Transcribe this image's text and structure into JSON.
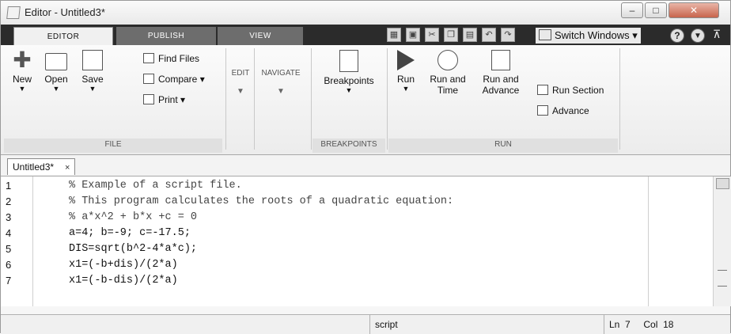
{
  "window": {
    "title": "Editor - Untitled3*"
  },
  "tabs": [
    {
      "label": "EDITOR"
    },
    {
      "label": "PUBLISH"
    },
    {
      "label": "VIEW"
    }
  ],
  "toolbar": {
    "switch_windows": "Switch Windows",
    "help_icon": "question-icon"
  },
  "ribbon": {
    "file": {
      "new": "New",
      "open": "Open",
      "save": "Save",
      "find_files": "Find Files",
      "compare": "Compare",
      "print": "Print",
      "section": "FILE"
    },
    "edit": "EDIT",
    "navigate": "NAVIGATE",
    "breakpoints": {
      "button": "Breakpoints",
      "section": "BREAKPOINTS"
    },
    "run": {
      "run": "Run",
      "run_and_time_1": "Run and",
      "run_and_time_2": "Time",
      "run_and_advance_1": "Run and",
      "run_and_advance_2": "Advance",
      "run_section": "Run Section",
      "advance": "Advance",
      "section": "RUN"
    }
  },
  "doc_tab": {
    "label": "Untitled3*",
    "close": "×"
  },
  "editor": {
    "lines": [
      {
        "num": "1",
        "text": "% Example of a script file."
      },
      {
        "num": "2",
        "text": "% This program calculates the roots of a quadratic equation:"
      },
      {
        "num": "3",
        "text": "% a*x^2 + b*x +c = 0"
      },
      {
        "num": "4",
        "text": "a=4; b=-9; c=-17.5;"
      },
      {
        "num": "5",
        "text": "DIS=sqrt(b^2-4*a*c);"
      },
      {
        "num": "6",
        "text": "x1=(-b+dis)/(2*a)"
      },
      {
        "num": "7",
        "text": "x1=(-b-dis)/(2*a)"
      }
    ]
  },
  "status": {
    "mode": "script",
    "ln_label": "Ln",
    "ln_value": "7",
    "col_label": "Col",
    "col_value": "18"
  }
}
